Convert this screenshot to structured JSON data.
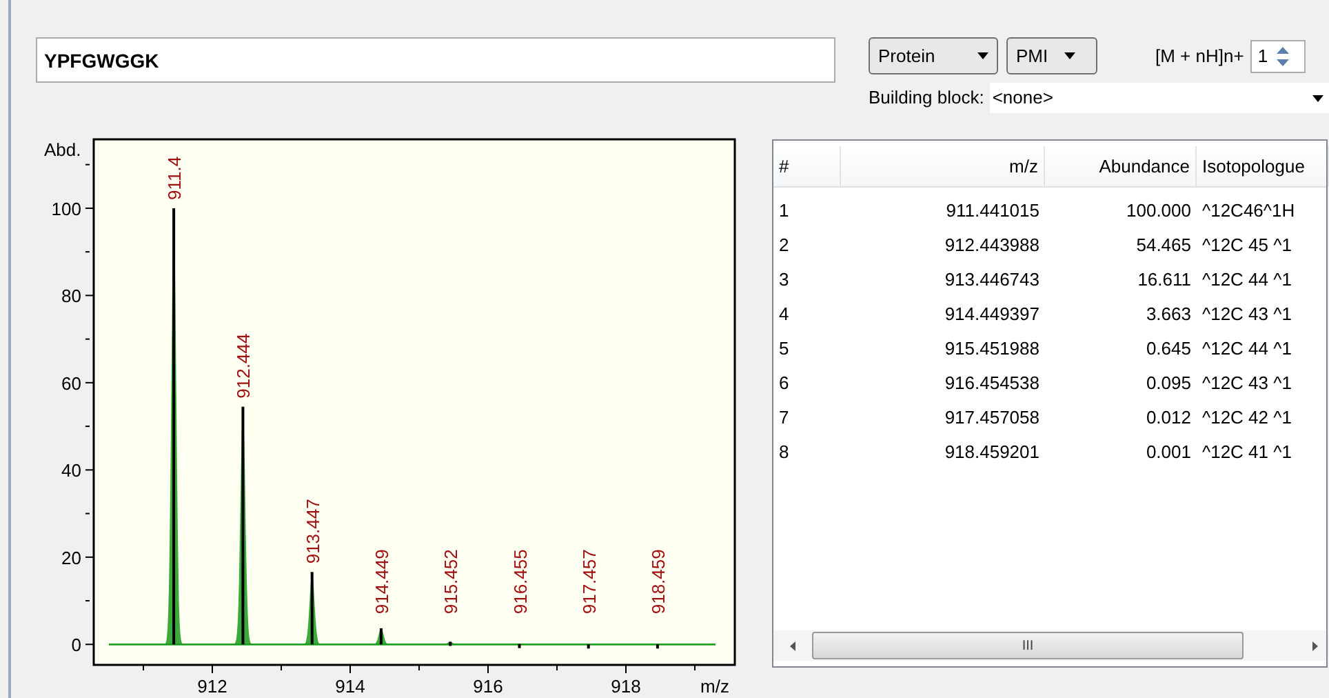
{
  "sequence_field": {
    "value": "YPFGWGGK"
  },
  "type_select": {
    "value": "Protein"
  },
  "mode_select": {
    "value": "PMI"
  },
  "charge": {
    "label": "[M + nH]n+",
    "value": "1"
  },
  "building_block": {
    "label": "Building block:",
    "value": "<none>"
  },
  "spectrum": {
    "chart_data": {
      "type": "bar",
      "xlabel": "m/z",
      "ylabel": "Abd.",
      "x": [
        911.441,
        912.444,
        913.447,
        914.449,
        915.452,
        916.455,
        917.457,
        918.459
      ],
      "values": [
        100,
        54.5,
        16.6,
        3.7,
        0.6,
        0.1,
        0,
        0
      ],
      "annotations": [
        {
          "x": 911.441,
          "y": 100,
          "text": "911.4"
        },
        {
          "x": 912.444,
          "y": 54.5,
          "text": "912.444"
        },
        {
          "x": 913.447,
          "y": 16.6,
          "text": "913.447"
        },
        {
          "x": 914.449,
          "y": 3.7,
          "text": "914.449"
        },
        {
          "x": 915.452,
          "y": 0.6,
          "text": "915.452"
        },
        {
          "x": 916.455,
          "y": 0.1,
          "text": "916.455"
        },
        {
          "x": 917.457,
          "y": 0,
          "text": "917.457"
        },
        {
          "x": 918.459,
          "y": 0,
          "text": "918.459"
        }
      ],
      "xlim": [
        910.28,
        919.58
      ],
      "ylim": [
        -4.7,
        115.8
      ],
      "xticks": [
        912,
        914,
        916,
        918
      ],
      "yticks": [
        0,
        20,
        40,
        60,
        80,
        100
      ]
    }
  },
  "table": {
    "columns": [
      "#",
      "m/z",
      "Abundance",
      "Isotopologue"
    ],
    "rows": [
      [
        "1",
        "911.441015",
        "100.000",
        "^12C46^1H"
      ],
      [
        "2",
        "912.443988",
        "54.465",
        "^12C 45 ^1"
      ],
      [
        "3",
        "913.446743",
        "16.611",
        "^12C 44 ^1"
      ],
      [
        "4",
        "914.449397",
        "3.663",
        "^12C 43 ^1"
      ],
      [
        "5",
        "915.451988",
        "0.645",
        "^12C 44 ^1"
      ],
      [
        "6",
        "916.454538",
        "0.095",
        "^12C 43 ^1"
      ],
      [
        "7",
        "917.457058",
        "0.012",
        "^12C 42 ^1"
      ],
      [
        "8",
        "918.459201",
        "0.001",
        "^12C 41 ^1"
      ]
    ],
    "scrollbar_thumb": "III"
  }
}
